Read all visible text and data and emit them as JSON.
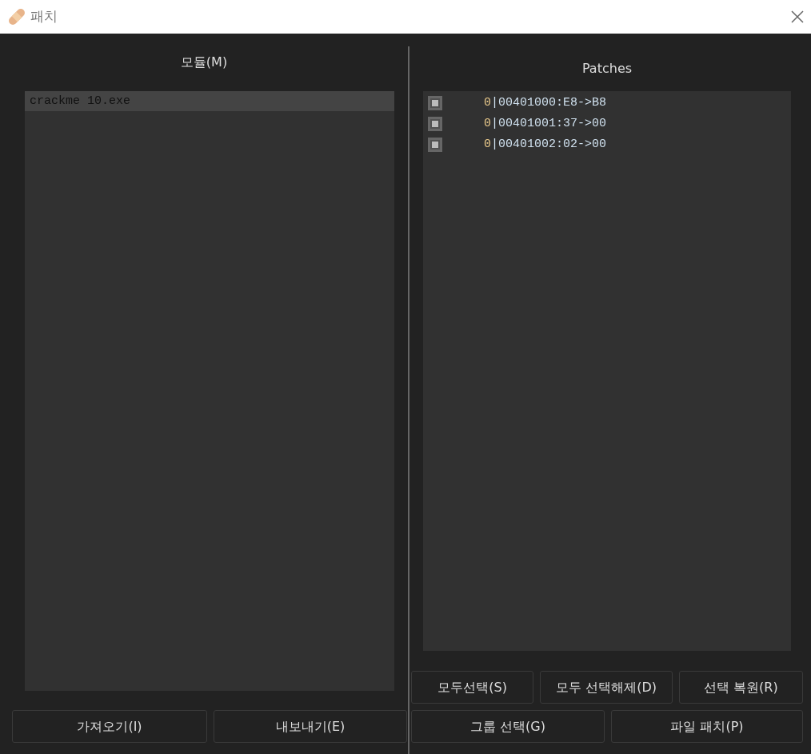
{
  "window": {
    "title": "패치"
  },
  "modules": {
    "heading": "모듈(M)",
    "items": [
      {
        "label": "crackme 10.exe",
        "selected": true
      }
    ]
  },
  "patches": {
    "heading": "Patches",
    "items": [
      {
        "group": "0",
        "text": "|00401000:E8->B8",
        "checked": true
      },
      {
        "group": "0",
        "text": "|00401001:37->00",
        "checked": true
      },
      {
        "group": "0",
        "text": "|00401002:02->00",
        "checked": true
      }
    ]
  },
  "left_buttons": [
    "가져오기(I)",
    "내보내기(E)"
  ],
  "right_buttons_top": [
    "모두선택(S)",
    "모두 선택해제(D)",
    "선택 복원(R)"
  ],
  "right_buttons_bottom": [
    "그룹 선택(G)",
    "파일 패치(P)"
  ]
}
